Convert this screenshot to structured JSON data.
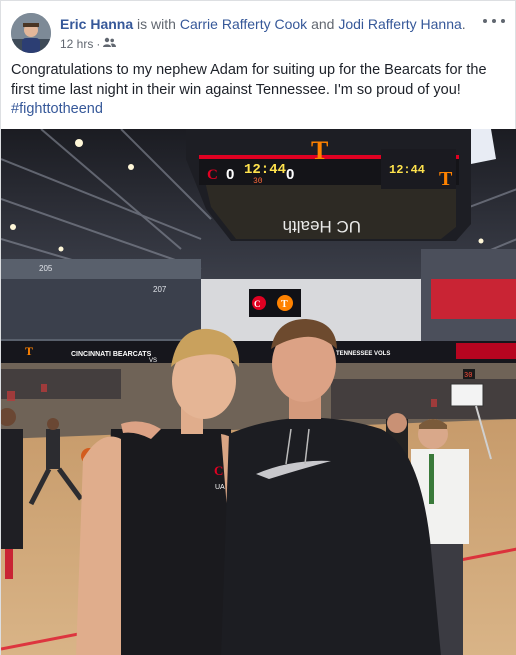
{
  "post": {
    "author": "Eric Hanna",
    "with_text": "is with",
    "tagged_1": "Carrie Rafferty Cook",
    "and_text": "and",
    "tagged_2": "Jodi Rafferty Hanna",
    "end_punct": ".",
    "time": "12 hrs",
    "time_sep": "·",
    "audience_icon": "friends-icon",
    "caption": "Congratulations to my nephew Adam for suiting up for the Bearcats for the first time last night in their win against Tennessee. I'm so proud of you!",
    "hashtag": "#fighttotheend"
  },
  "photo": {
    "scoreboard": {
      "home_score": "0",
      "clock": "12:44",
      "shot_clock": "30",
      "away_score": "0",
      "brand": "UC Health",
      "team_letter": "T"
    },
    "ribbon": {
      "left_text": "CINCINNATI BEARCATS",
      "vs": "VS",
      "right_text": "TENNESSEE VOLS"
    },
    "section_numbers": [
      "205",
      "207"
    ],
    "court_shot_clock": "30",
    "colors": {
      "bearcats_red": "#e00122",
      "vols_orange": "#ff8200",
      "link_blue": "#365899"
    }
  }
}
